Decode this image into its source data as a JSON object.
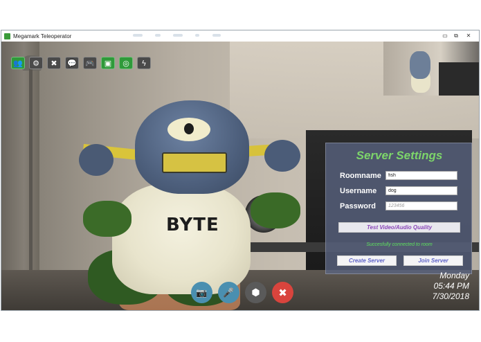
{
  "window": {
    "title": "Megamark Teleoperator"
  },
  "window_controls": {
    "minimize": "▭",
    "restore": "⧉",
    "close": "✕"
  },
  "toolbar": {
    "icons": [
      {
        "name": "users-icon",
        "glyph": "👥"
      },
      {
        "name": "gear-icon",
        "glyph": "⚙"
      },
      {
        "name": "tools-icon",
        "glyph": "✖"
      },
      {
        "name": "chat-icon",
        "glyph": "💬"
      },
      {
        "name": "gamepad-icon",
        "glyph": "🎮"
      },
      {
        "name": "image-icon",
        "glyph": "▣"
      },
      {
        "name": "compass-icon",
        "glyph": "◎"
      },
      {
        "name": "lightning-icon",
        "glyph": "ϟ"
      }
    ]
  },
  "server_settings": {
    "title": "Server Settings",
    "roomname_label": "Roomname",
    "roomname_value": "fish",
    "username_label": "Username",
    "username_value": "dog",
    "password_label": "Password",
    "password_placeholder": "123456",
    "test_button": "Test Video/Audio Quality",
    "status": "Succesfully connected to room",
    "create_button": "Create Server",
    "join_button": "Join Server"
  },
  "datetime": {
    "day": "Monday",
    "time": "05:44 PM",
    "date": "7/30/2018"
  },
  "bottom_controls": {
    "camera": "📷",
    "mic": "🎤",
    "cube": "⬢",
    "close": "✖"
  },
  "video": {
    "plush_text": "BYTE"
  },
  "colors": {
    "tool_green": "#2f9a3a",
    "tool_gray": "#4a4a4a",
    "accent_title": "#7dd56a",
    "status_green": "#5de05d",
    "round_blue": "#4a8fb0",
    "round_gray": "#5a5a5a",
    "round_red": "#d9443d"
  }
}
